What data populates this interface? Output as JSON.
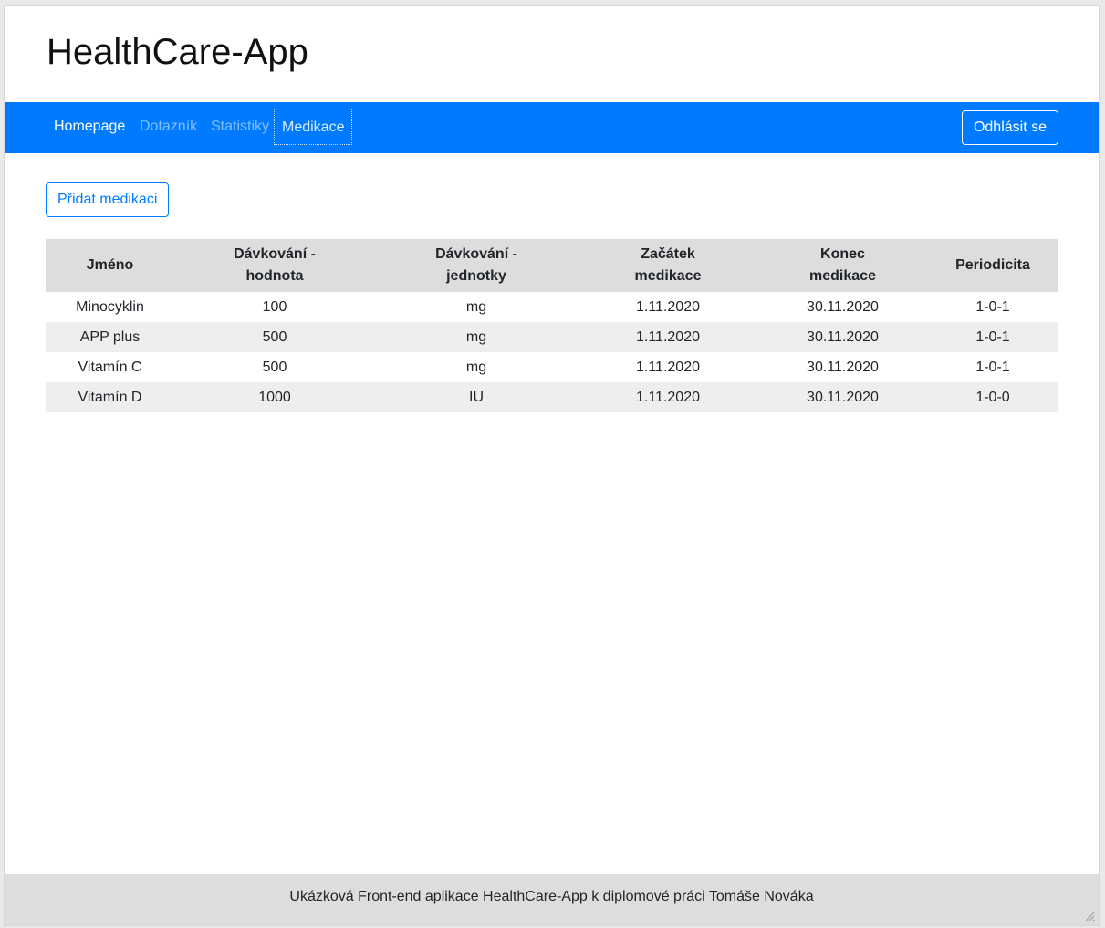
{
  "header": {
    "title": "HealthCare-App"
  },
  "nav": {
    "items": [
      {
        "label": "Homepage"
      },
      {
        "label": "Dotazník"
      },
      {
        "label": "Statistiky"
      },
      {
        "label": "Medikace"
      }
    ],
    "logout_label": "Odhlásit se"
  },
  "main": {
    "add_label": "Přidat medikaci",
    "table": {
      "headers": [
        [
          "Jméno"
        ],
        [
          "Dávkování -",
          "hodnota"
        ],
        [
          "Dávkování -",
          "jednotky"
        ],
        [
          "Začátek",
          "medikace"
        ],
        [
          "Konec",
          "medikace"
        ],
        [
          "Periodicita"
        ]
      ],
      "rows": [
        [
          "Minocyklin",
          "100",
          "mg",
          "1.11.2020",
          "30.11.2020",
          "1-0-1"
        ],
        [
          "APP plus",
          "500",
          "mg",
          "1.11.2020",
          "30.11.2020",
          "1-0-1"
        ],
        [
          "Vitamín C",
          "500",
          "mg",
          "1.11.2020",
          "30.11.2020",
          "1-0-1"
        ],
        [
          "Vitamín D",
          "1000",
          "IU",
          "1.11.2020",
          "30.11.2020",
          "1-0-0"
        ]
      ]
    }
  },
  "footer": {
    "text": "Ukázková Front-end aplikace HealthCare-App k diplomové práci Tomáše Nováka"
  },
  "colors": {
    "primary": "#007bff",
    "header_bg": "#dddddd",
    "stripe": "#eeeeee"
  }
}
